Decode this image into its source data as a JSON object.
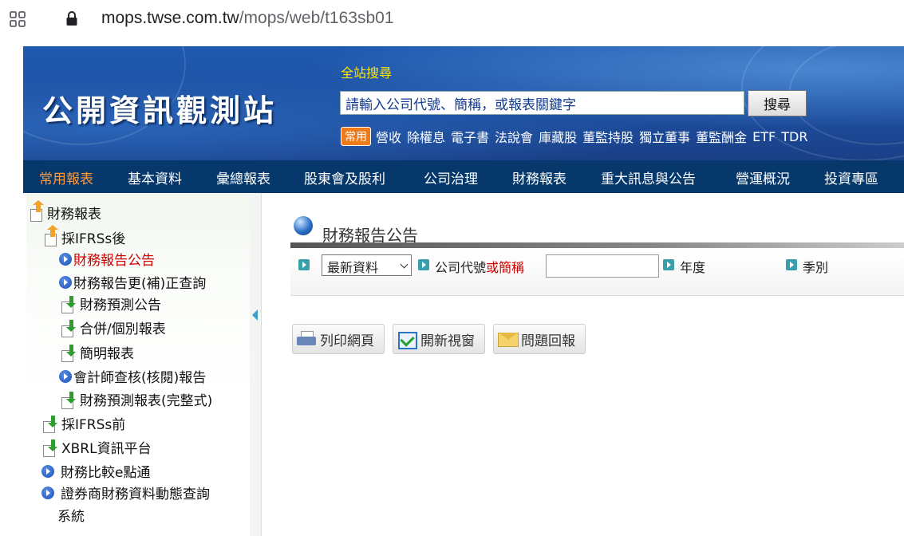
{
  "browser": {
    "url_host": "mops.twse.com.tw",
    "url_path": "/mops/web/t163sb01"
  },
  "header": {
    "logo_text": "公開資訊觀測站",
    "search_label": "全站搜尋",
    "search_placeholder": "請輸入公司代號、簡稱，或報表關鍵字",
    "search_button": "搜尋",
    "quick_badge": "常用",
    "quick_links": [
      "營收",
      "除權息",
      "電子書",
      "法說會",
      "庫藏股",
      "董監持股",
      "獨立董事",
      "董監酬金",
      "ETF",
      "TDR"
    ]
  },
  "nav": {
    "items": [
      "常用報表",
      "基本資料",
      "彙總報表",
      "股東會及股利",
      "公司治理",
      "財務報表",
      "重大訊息與公告",
      "營運概況",
      "投資專區"
    ],
    "active_index": 0
  },
  "sidebar": {
    "root": "財務報表",
    "ifrs_after": "採IFRSs後",
    "ifrs_after_items": [
      "財務報告公告",
      "財務報告更(補)正查詢",
      "財務預測公告",
      "合併/個別報表",
      "簡明報表",
      "會計師查核(核閱)報告",
      "財務預測報表(完整式)"
    ],
    "ifrs_before": "採IFRSs前",
    "xbrl": "XBRL資訊平台",
    "compare": "財務比較e點通",
    "broker_line1": "證券商財務資料動態查詢",
    "broker_line2": "系統",
    "selected": "財務報告公告"
  },
  "content": {
    "title": "財務報告公告",
    "filter": {
      "select_value": "最新資料",
      "company_label": "公司代號",
      "company_label_red": "或簡稱",
      "company_value": "",
      "year_label": "年度",
      "season_label": "季別"
    },
    "tools": {
      "print": "列印網頁",
      "new_window": "開新視窗",
      "report": "問題回報"
    }
  },
  "colors": {
    "header_blue": "#1d4fa0",
    "nav_dark_blue": "#06386b",
    "nav_active": "#ff9a3c",
    "search_label_yellow": "#ffe600",
    "badge_orange": "#f07b1b",
    "selected_red": "#cc0000"
  }
}
